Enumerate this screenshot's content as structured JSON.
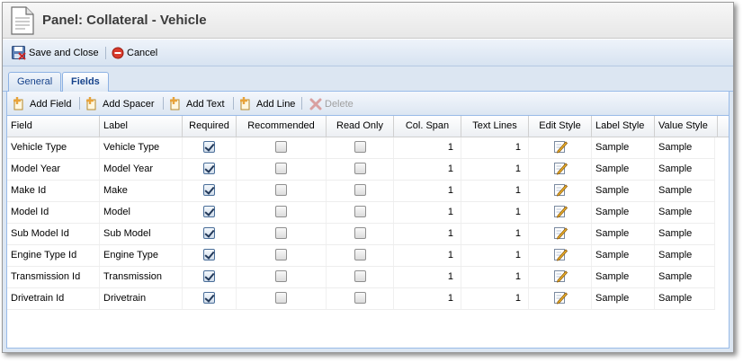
{
  "window": {
    "title": "Panel: Collateral - Vehicle"
  },
  "toolbar": {
    "save_close_label": "Save and Close",
    "cancel_label": "Cancel"
  },
  "tabs": [
    {
      "label": "General",
      "active": false
    },
    {
      "label": "Fields",
      "active": true
    }
  ],
  "grid_toolbar": {
    "add_field_label": "Add Field",
    "add_spacer_label": "Add Spacer",
    "add_text_label": "Add Text",
    "add_line_label": "Add Line",
    "delete_label": "Delete"
  },
  "grid": {
    "columns": [
      "Field",
      "Label",
      "Required",
      "Recommended",
      "Read Only",
      "Col. Span",
      "Text Lines",
      "Edit Style",
      "Label Style",
      "Value Style"
    ],
    "rows": [
      {
        "field": "Vehicle Type",
        "label": "Vehicle Type",
        "required": true,
        "recommended": false,
        "read_only": false,
        "col_span": "1",
        "text_lines": "1",
        "label_style": "Sample",
        "value_style": "Sample"
      },
      {
        "field": "Model Year",
        "label": "Model Year",
        "required": true,
        "recommended": false,
        "read_only": false,
        "col_span": "1",
        "text_lines": "1",
        "label_style": "Sample",
        "value_style": "Sample"
      },
      {
        "field": "Make Id",
        "label": "Make",
        "required": true,
        "recommended": false,
        "read_only": false,
        "col_span": "1",
        "text_lines": "1",
        "label_style": "Sample",
        "value_style": "Sample"
      },
      {
        "field": "Model Id",
        "label": "Model",
        "required": true,
        "recommended": false,
        "read_only": false,
        "col_span": "1",
        "text_lines": "1",
        "label_style": "Sample",
        "value_style": "Sample"
      },
      {
        "field": "Sub Model Id",
        "label": "Sub Model",
        "required": true,
        "recommended": false,
        "read_only": false,
        "col_span": "1",
        "text_lines": "1",
        "label_style": "Sample",
        "value_style": "Sample"
      },
      {
        "field": "Engine Type Id",
        "label": "Engine Type",
        "required": true,
        "recommended": false,
        "read_only": false,
        "col_span": "1",
        "text_lines": "1",
        "label_style": "Sample",
        "value_style": "Sample"
      },
      {
        "field": "Transmission Id",
        "label": "Transmission",
        "required": true,
        "recommended": false,
        "read_only": false,
        "col_span": "1",
        "text_lines": "1",
        "label_style": "Sample",
        "value_style": "Sample"
      },
      {
        "field": "Drivetrain Id",
        "label": "Drivetrain",
        "required": true,
        "recommended": false,
        "read_only": false,
        "col_span": "1",
        "text_lines": "1",
        "label_style": "Sample",
        "value_style": "Sample"
      }
    ]
  },
  "colors": {
    "tab_text": "#15428b",
    "toolbar_bg": "#dce6f2",
    "border_accent": "#99bbe8",
    "cancel_red": "#d83a2c",
    "add_icon_orange": "#e8a33a",
    "delete_disabled": "#d9a0a0"
  },
  "icons": {
    "window": "document-icon",
    "save_close": "save-close-icon",
    "cancel": "cancel-icon",
    "add": "add-plus-icon",
    "delete": "delete-x-icon",
    "edit_style": "edit-style-icon",
    "checkbox": "checkbox"
  }
}
